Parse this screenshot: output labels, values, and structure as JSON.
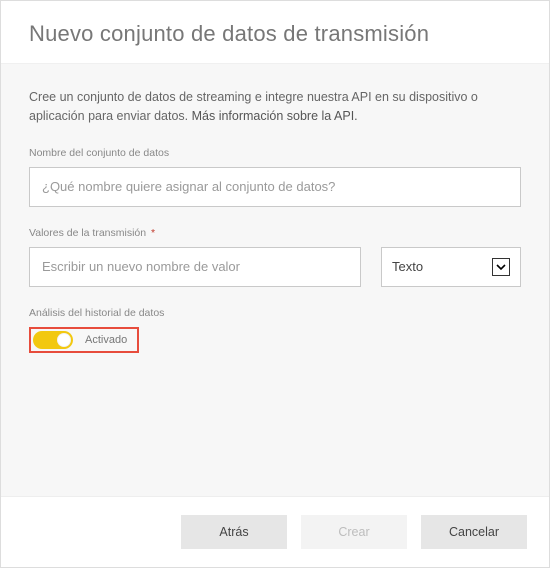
{
  "header": {
    "title": "Nuevo conjunto de datos de transmisión"
  },
  "description": {
    "line1": "Cree un conjunto de datos de streaming e integre nuestra API en su dispositivo o",
    "line2_part1": "aplicación para enviar datos. ",
    "line2_link": "Más información sobre la API."
  },
  "dataset_name": {
    "label": "Nombre del conjunto de datos",
    "placeholder": "¿Qué nombre quiere asignar al conjunto de datos?",
    "value": ""
  },
  "stream_values": {
    "label": "Valores de la transmisión",
    "required_marker": "*",
    "name_placeholder": "Escribir un nuevo nombre de valor",
    "name_value": "",
    "type_selected": "Texto"
  },
  "history": {
    "label": "Análisis del historial de datos",
    "state_label": "Activado",
    "on": true
  },
  "footer": {
    "back": "Atrás",
    "create": "Crear",
    "cancel": "Cancelar"
  }
}
